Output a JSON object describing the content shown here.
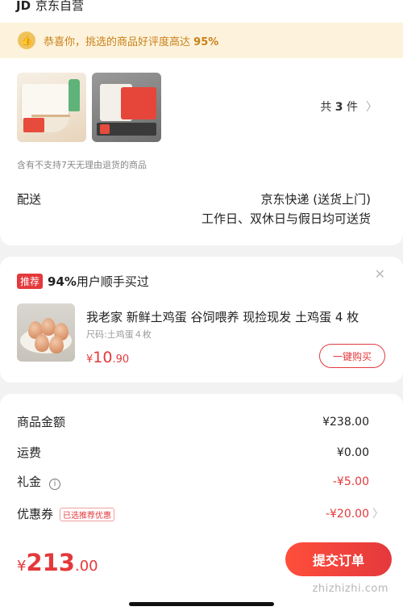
{
  "order": {
    "shop_name": "京东自营",
    "shop_logo": "JD",
    "praise_prefix": "恭喜你，挑选的商品好评度高达",
    "praise_percent": "95%",
    "item_count_prefix": "共",
    "item_count": "3",
    "item_count_suffix": "件",
    "return_note": "含有不支持7天无理由退货的商品",
    "delivery_label": "配送",
    "delivery_method": "京东快递 (送货上门)",
    "delivery_time": "工作日、双休日与假日均可送货"
  },
  "recommend": {
    "badge": "推荐",
    "percent": "94%",
    "headline": "用户顺手买过",
    "title": "我老家 新鲜土鸡蛋 谷饲喂养 现捡现发 土鸡蛋 4 枚",
    "spec": "尺码:土鸡蛋４枚",
    "price_currency": "¥",
    "price_int": "10",
    "price_dec": ".90",
    "buy_label": "一键购买"
  },
  "summary": {
    "rows": [
      {
        "label": "商品金额",
        "value": "¥238.00",
        "red": false
      },
      {
        "label": "运费",
        "value": "¥0.00",
        "red": false
      },
      {
        "label": "礼金",
        "value": "-¥5.00",
        "red": true
      },
      {
        "label": "优惠券",
        "value": "-¥20.00",
        "red": true
      }
    ],
    "coupon_tag": "已选推荐优惠",
    "total_currency": "¥",
    "total_int": "213",
    "total_dec": ".00",
    "submit_label": "提交订单"
  },
  "watermark": "zhizhizhi.com",
  "colors": {
    "accent": "#e4393c",
    "praise_bg": "#fdf3dc",
    "praise_text": "#c9811a"
  }
}
